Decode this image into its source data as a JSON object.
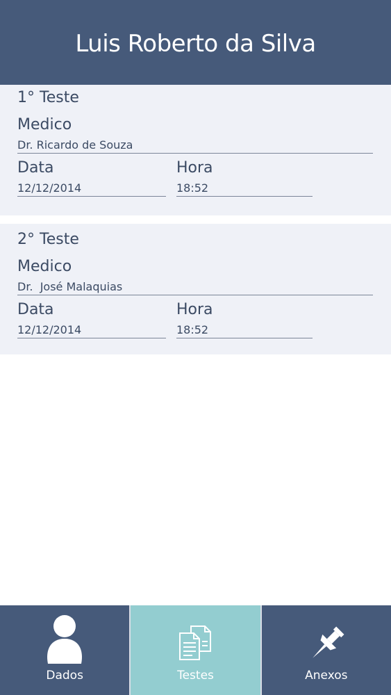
{
  "header": {
    "patient_name": "Luis Roberto da Silva"
  },
  "tests": [
    {
      "title": "1° Teste",
      "medico_label": "Medico",
      "medico": "Dr. Ricardo de Souza",
      "data_label": "Data",
      "data": "12/12/2014",
      "hora_label": "Hora",
      "hora": "18:52"
    },
    {
      "title": "2° Teste",
      "medico_label": "Medico",
      "medico": "Dr.  José Malaquias",
      "data_label": "Data",
      "data": "12/12/2014",
      "hora_label": "Hora",
      "hora": "18:52"
    }
  ],
  "tabbar": {
    "tabs": [
      {
        "label": "Dados",
        "icon": "person-icon"
      },
      {
        "label": "Testes",
        "icon": "documents-icon",
        "active": true
      },
      {
        "label": "Anexos",
        "icon": "pushpin-icon"
      }
    ]
  },
  "colors": {
    "header": "#465a7a",
    "card_bg": "#eff1f7",
    "active_tab": "#93cdd0"
  }
}
